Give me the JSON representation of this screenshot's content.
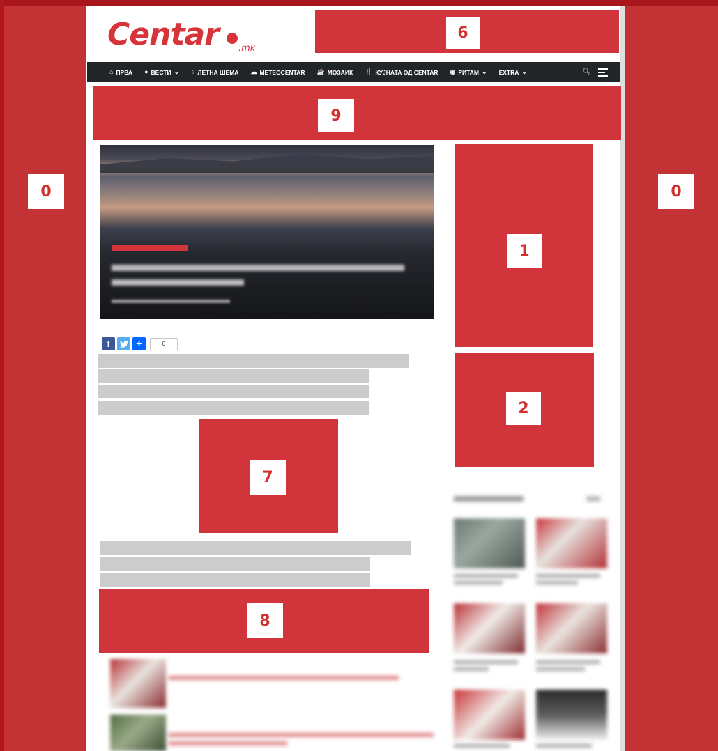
{
  "site": {
    "logo_text": "Centar",
    "logo_tld": ".mk"
  },
  "nav": {
    "items": [
      {
        "label": "ПРВА",
        "icon": "home-icon",
        "has_dropdown": false
      },
      {
        "label": "ВЕСТИ",
        "icon": "globe-icon",
        "has_dropdown": true
      },
      {
        "label": "ЛЕТНА ШЕМА",
        "icon": "circle-icon",
        "has_dropdown": false
      },
      {
        "label": "METEOCENTAR",
        "icon": "cloud-icon",
        "has_dropdown": false
      },
      {
        "label": "МОЗАИК",
        "icon": "coffee-icon",
        "has_dropdown": false
      },
      {
        "label": "КУЈНАТА ОД CENTAR",
        "icon": "cutlery-icon",
        "has_dropdown": false
      },
      {
        "label": "РИТАМ",
        "icon": "disc-icon",
        "has_dropdown": true
      },
      {
        "label": "EXTRA",
        "icon": "",
        "has_dropdown": true
      }
    ],
    "right_icons": [
      "search-icon",
      "menu-icon"
    ]
  },
  "share": {
    "buttons": [
      "facebook",
      "twitter",
      "addthis"
    ],
    "count": "0"
  },
  "ad_slots": [
    {
      "id": "0",
      "position": "left-rail"
    },
    {
      "id": "0",
      "position": "right-rail"
    },
    {
      "id": "6",
      "position": "header-banner"
    },
    {
      "id": "9",
      "position": "top-leaderboard"
    },
    {
      "id": "1",
      "position": "sidebar-top"
    },
    {
      "id": "2",
      "position": "sidebar-second"
    },
    {
      "id": "7",
      "position": "in-article"
    },
    {
      "id": "8",
      "position": "below-article"
    }
  ],
  "colors": {
    "brand_red": "#d7343a",
    "ad_red": "#d1343a",
    "nav_bg": "#222528",
    "facebook": "#3b5998",
    "twitter": "#55acee",
    "addthis": "#0166ff"
  }
}
